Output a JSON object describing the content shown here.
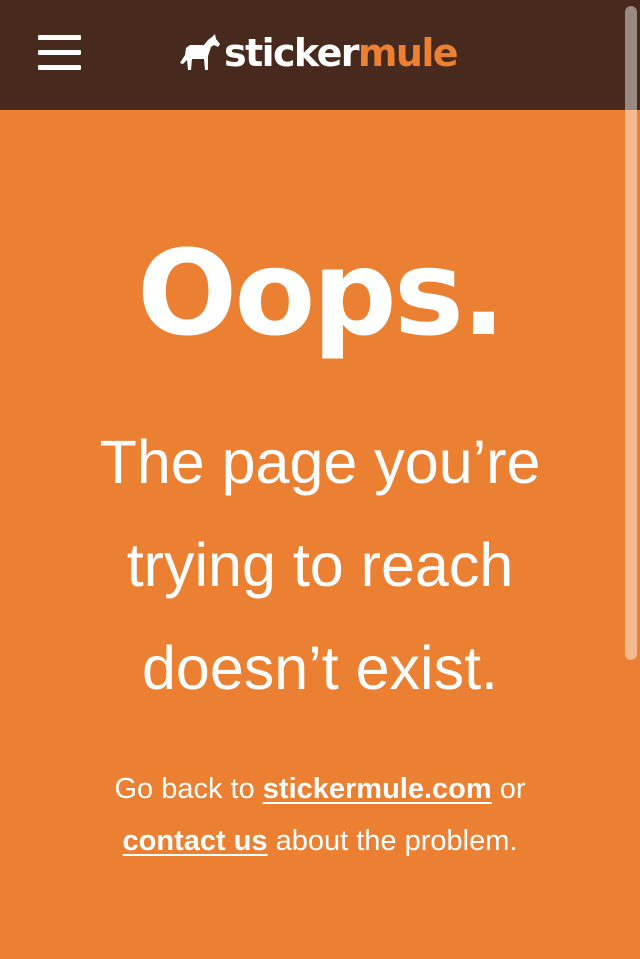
{
  "header": {
    "menu_icon": "hamburger-menu-icon",
    "logo_icon": "mule-icon",
    "logo_sticker": "sticker",
    "logo_mule": "mule",
    "colors": {
      "background": "#48291E",
      "accent": "#EC8032"
    }
  },
  "main": {
    "background": "#EC8032",
    "headline": "Oops.",
    "message_lines": [
      "The page you’re",
      "trying to reach",
      "doesn’t exist."
    ],
    "note": {
      "prefix": "Go back to ",
      "home_link": "stickermule.com",
      "middle": " or",
      "contact_link": "contact us",
      "suffix": " about the problem."
    }
  }
}
